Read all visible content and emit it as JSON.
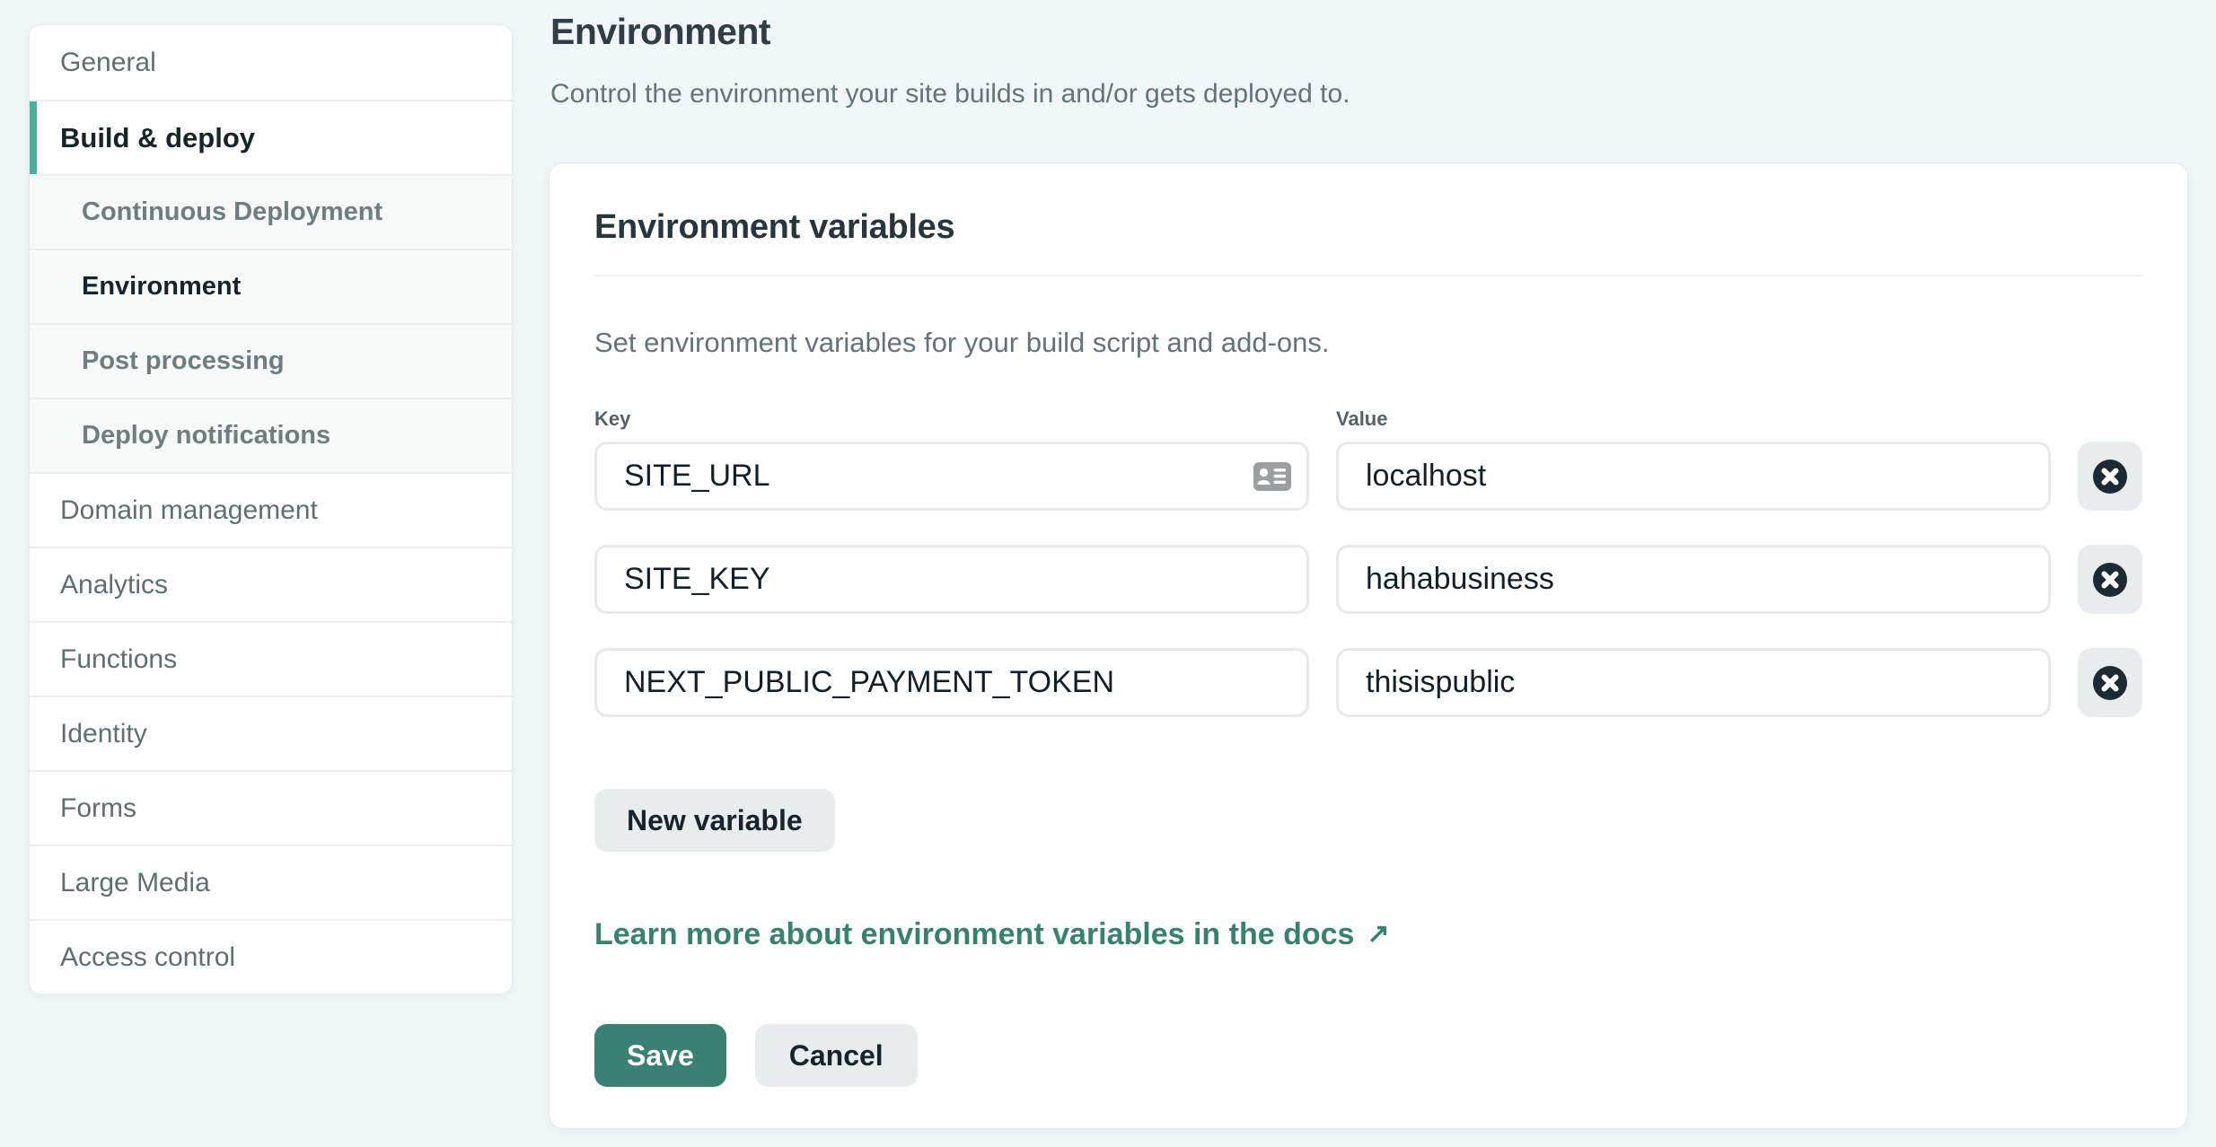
{
  "theme": {
    "page_bg": "#f1f7f8",
    "accent": "#47b1a1",
    "btn_teal": "#3a8173",
    "link_teal": "#37816f"
  },
  "sidebar": {
    "items": [
      {
        "label": "General",
        "level": "top",
        "active": false
      },
      {
        "label": "Build & deploy",
        "level": "top",
        "active": true
      },
      {
        "label": "Continuous Deployment",
        "level": "sub",
        "active": false
      },
      {
        "label": "Environment",
        "level": "sub",
        "active": true
      },
      {
        "label": "Post processing",
        "level": "sub",
        "active": false
      },
      {
        "label": "Deploy notifications",
        "level": "sub",
        "active": false
      },
      {
        "label": "Domain management",
        "level": "top",
        "active": false
      },
      {
        "label": "Analytics",
        "level": "top",
        "active": false
      },
      {
        "label": "Functions",
        "level": "top",
        "active": false
      },
      {
        "label": "Identity",
        "level": "top",
        "active": false
      },
      {
        "label": "Forms",
        "level": "top",
        "active": false
      },
      {
        "label": "Large Media",
        "level": "top",
        "active": false
      },
      {
        "label": "Access control",
        "level": "top",
        "active": false
      }
    ]
  },
  "header": {
    "title": "Environment",
    "subtitle": "Control the environment your site builds in and/or gets deployed to."
  },
  "card": {
    "title": "Environment variables",
    "description": "Set environment variables for your build script and add-ons.",
    "key_label": "Key",
    "value_label": "Value",
    "variables": [
      {
        "key": "SITE_URL",
        "value": "localhost",
        "autofill_icon": true
      },
      {
        "key": "SITE_KEY",
        "value": "hahabusiness",
        "autofill_icon": false
      },
      {
        "key": "NEXT_PUBLIC_PAYMENT_TOKEN",
        "value": "thisispublic",
        "autofill_icon": false
      }
    ],
    "icons": {
      "delete": "circle-x-icon",
      "autofill": "contact-card-icon"
    },
    "new_variable_label": "New variable",
    "docs_link": {
      "text": "Learn more about environment variables in the docs",
      "arrow": "↗"
    },
    "save_label": "Save",
    "cancel_label": "Cancel"
  }
}
